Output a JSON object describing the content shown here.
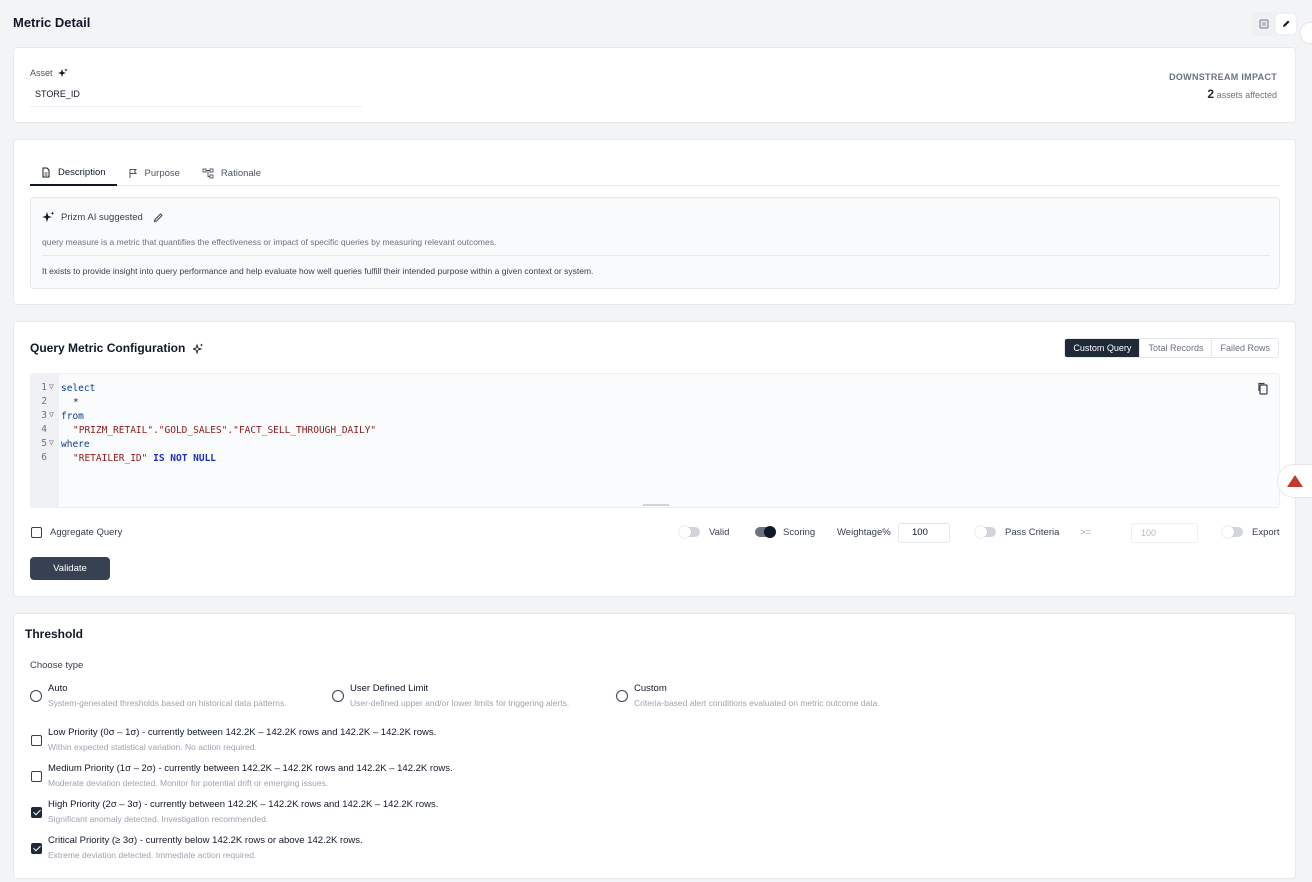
{
  "page": {
    "title": "Metric Detail"
  },
  "asset": {
    "label": "Asset",
    "value": "STORE_ID",
    "impact_title": "DOWNSTREAM IMPACT",
    "impact_count": "2",
    "impact_suffix": "assets affected"
  },
  "description": {
    "tabs": [
      {
        "label": "Description",
        "icon": "document-icon"
      },
      {
        "label": "Purpose",
        "icon": "flag-icon"
      },
      {
        "label": "Rationale",
        "icon": "flow-icon"
      }
    ],
    "suggested_label": "Prizm AI suggested",
    "line1": "query measure is a metric that quantifies the effectiveness or impact of specific queries by measuring relevant outcomes.",
    "line2": "It exists to provide insight into query performance and help evaluate how well queries fulfill their intended purpose within a given context or system."
  },
  "query": {
    "title": "Query Metric Configuration",
    "modes": [
      "Custom Query",
      "Total Records",
      "Failed Rows"
    ],
    "active_mode": "Custom Query",
    "code": {
      "l1": "select",
      "l2": "*",
      "l3": "from",
      "l4": "\"PRIZM_RETAIL\".\"GOLD_SALES\".\"FACT_SELL_THROUGH_DAILY\"",
      "l5": "where",
      "l6_str": "\"RETAILER_ID\"",
      "l6_kw": "IS NOT NULL"
    },
    "line_numbers": [
      "1",
      "2",
      "3",
      "4",
      "5",
      "6"
    ],
    "aggregate_label": "Aggregate Query",
    "aggregate_checked": false,
    "valid_label": "Valid",
    "valid_on": false,
    "scoring_label": "Scoring",
    "scoring_on": true,
    "weightage_label": "Weightage%",
    "weightage_value": "100",
    "pass_label": "Pass Criteria",
    "pass_on": false,
    "pass_operator": ">=",
    "pass_placeholder": "100",
    "export_label": "Export",
    "export_on": false,
    "validate_label": "Validate"
  },
  "threshold": {
    "title": "Threshold",
    "choose_label": "Choose type",
    "types": [
      {
        "title": "Auto",
        "desc": "System-generated thresholds based on historical data patterns."
      },
      {
        "title": "User Defined Limit",
        "desc": "User-defined upper and/or lower limits for triggering alerts."
      },
      {
        "title": "Custom",
        "desc": "Criteria-based alert conditions evaluated on metric outcome data."
      }
    ],
    "priorities": [
      {
        "title": "Low Priority (0σ – 1σ) - currently between 142.2K – 142.2K rows and 142.2K – 142.2K rows.",
        "desc": "Within expected statistical variation. No action required.",
        "checked": false
      },
      {
        "title": "Medium Priority (1σ – 2σ) - currently between 142.2K – 142.2K rows and 142.2K – 142.2K rows.",
        "desc": "Moderate deviation detected. Monitor for potential drift or emerging issues.",
        "checked": false
      },
      {
        "title": "High Priority (2σ – 3σ) - currently between 142.2K – 142.2K rows and 142.2K – 142.2K rows.",
        "desc": "Significant anomaly detected. Investigation recommended.",
        "checked": true
      },
      {
        "title": "Critical Priority (≥ 3σ) - currently below 142.2K rows or above 142.2K rows.",
        "desc": "Extreme deviation detected. Immediate action required.",
        "checked": true
      }
    ]
  },
  "colors": {
    "primary": "#1f2937",
    "alert": "#c0392b",
    "muted": "#9ca3af"
  }
}
